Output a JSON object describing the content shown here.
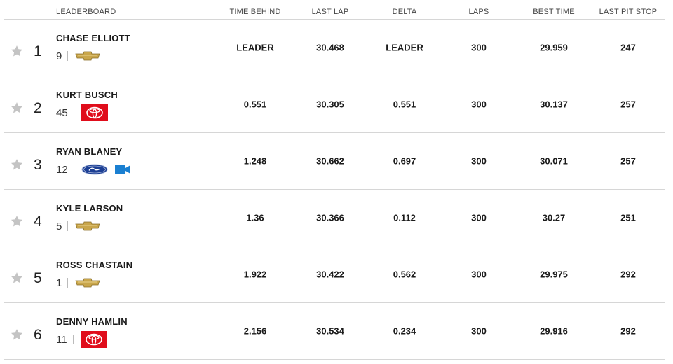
{
  "headers": {
    "leaderboard": "LEADERBOARD",
    "time_behind": "TIME BEHIND",
    "last_lap": "LAST LAP",
    "delta": "DELTA",
    "laps": "LAPS",
    "best_time": "BEST TIME",
    "last_pit_stop": "LAST PIT STOP"
  },
  "rows": [
    {
      "position": "1",
      "name": "CHASE ELLIOTT",
      "number": "9",
      "make": "chevrolet",
      "video": false,
      "time_behind": "LEADER",
      "last_lap": "30.468",
      "delta": "LEADER",
      "laps": "300",
      "best_time": "29.959",
      "last_pit_stop": "247"
    },
    {
      "position": "2",
      "name": "KURT BUSCH",
      "number": "45",
      "make": "toyota",
      "video": false,
      "time_behind": "0.551",
      "last_lap": "30.305",
      "delta": "0.551",
      "laps": "300",
      "best_time": "30.137",
      "last_pit_stop": "257"
    },
    {
      "position": "3",
      "name": "RYAN BLANEY",
      "number": "12",
      "make": "ford",
      "video": true,
      "time_behind": "1.248",
      "last_lap": "30.662",
      "delta": "0.697",
      "laps": "300",
      "best_time": "30.071",
      "last_pit_stop": "257"
    },
    {
      "position": "4",
      "name": "KYLE LARSON",
      "number": "5",
      "make": "chevrolet",
      "video": false,
      "time_behind": "1.36",
      "last_lap": "30.366",
      "delta": "0.112",
      "laps": "300",
      "best_time": "30.27",
      "last_pit_stop": "251"
    },
    {
      "position": "5",
      "name": "ROSS CHASTAIN",
      "number": "1",
      "make": "chevrolet",
      "video": false,
      "time_behind": "1.922",
      "last_lap": "30.422",
      "delta": "0.562",
      "laps": "300",
      "best_time": "29.975",
      "last_pit_stop": "292"
    },
    {
      "position": "6",
      "name": "DENNY HAMLIN",
      "number": "11",
      "make": "toyota",
      "video": false,
      "time_behind": "2.156",
      "last_lap": "30.534",
      "delta": "0.234",
      "laps": "300",
      "best_time": "29.916",
      "last_pit_stop": "292"
    }
  ],
  "colors": {
    "star": "#c4c4c4",
    "chevrolet_gold": "#c9a64b",
    "toyota_red": "#e00d1b",
    "ford_blue": "#1c3f94",
    "video_blue": "#1a7fd1",
    "divider": "#d6d6d6"
  },
  "icons": {
    "favorite": "star-icon",
    "chevrolet": "chevrolet-bowtie-icon",
    "toyota": "toyota-logo-icon",
    "ford": "ford-oval-icon",
    "video": "video-camera-icon"
  }
}
